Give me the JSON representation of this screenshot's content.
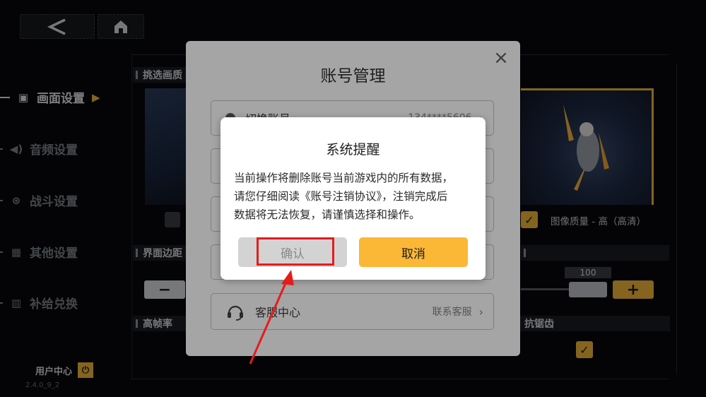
{
  "nav": {
    "back_icon": "chevron-left-icon",
    "home_icon": "home-icon"
  },
  "sidebar": {
    "items": [
      {
        "label": "画面设置",
        "icon": "display-icon",
        "active": true
      },
      {
        "label": "音频设置",
        "icon": "speaker-icon",
        "active": false
      },
      {
        "label": "战斗设置",
        "icon": "battle-icon",
        "active": false
      },
      {
        "label": "其他设置",
        "icon": "grid-icon",
        "active": false
      },
      {
        "label": "补给兑换",
        "icon": "gift-icon",
        "active": false
      }
    ],
    "user_center": "用户中心",
    "version": "2.4.0_9_2"
  },
  "settings": {
    "section_quality": "挑选画质",
    "section_margin": "界面边距",
    "section_fps": "高帧率",
    "section_aa": "抗锯齿",
    "quality_value": "图像质量 - 高（高清）",
    "slider_value": "100",
    "minus_label": "−",
    "plus_label": "+"
  },
  "account_dialog": {
    "title": "账号管理",
    "rows": [
      {
        "label": "切换账号",
        "value": "134****5606"
      },
      {
        "label": "客服中心",
        "value": "联系客服"
      }
    ],
    "chevron": "›",
    "close_label": "×"
  },
  "modal": {
    "title": "系统提醒",
    "body_lines": [
      "当前操作将删除账号当前游戏内的所有数据，",
      "请您仔细阅读《账号注销协议》，注销完成后",
      "数据将无法恢复，请谨慎选择和操作。"
    ],
    "confirm_label": "确认",
    "cancel_label": "取消"
  },
  "colors": {
    "accent": "#fbb736",
    "annotation": "#e51c1c"
  }
}
